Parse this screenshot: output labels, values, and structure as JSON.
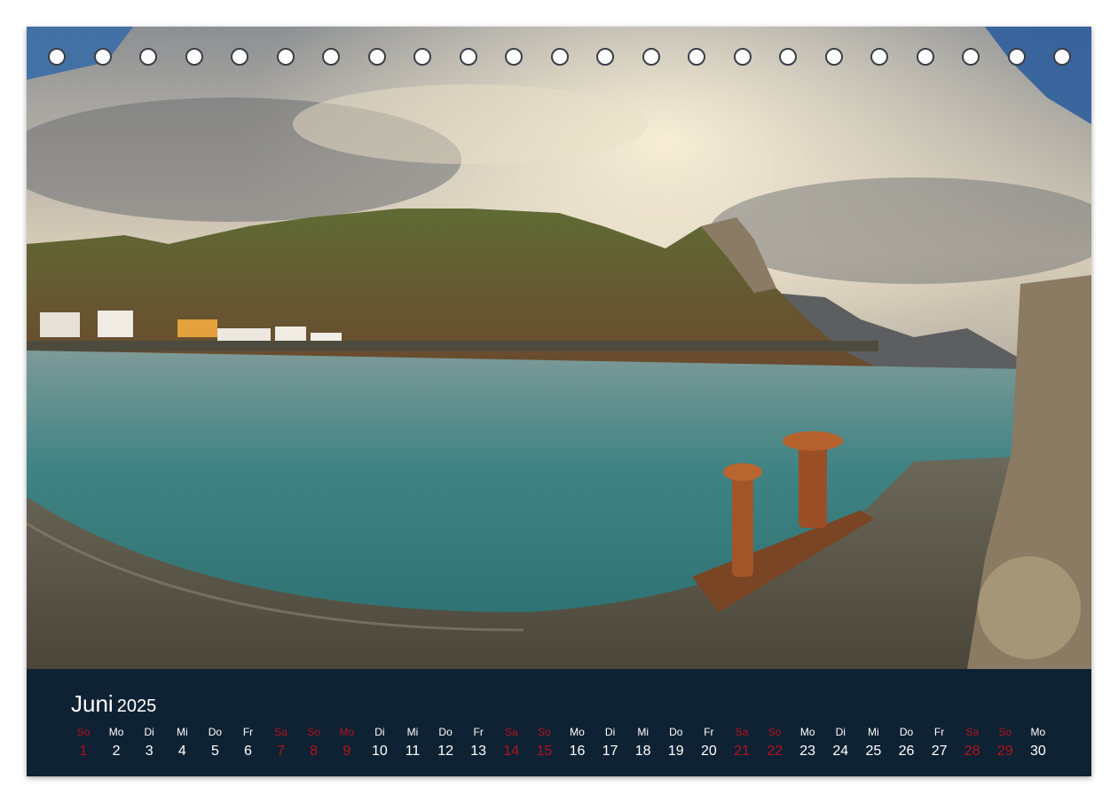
{
  "calendar": {
    "month": "Juni",
    "year": "2025",
    "weekend_color": "#b3121c",
    "days": [
      {
        "name": "So",
        "num": "1",
        "weekend": true
      },
      {
        "name": "Mo",
        "num": "2",
        "weekend": false
      },
      {
        "name": "Di",
        "num": "3",
        "weekend": false
      },
      {
        "name": "Mi",
        "num": "4",
        "weekend": false
      },
      {
        "name": "Do",
        "num": "5",
        "weekend": false
      },
      {
        "name": "Fr",
        "num": "6",
        "weekend": false
      },
      {
        "name": "Sa",
        "num": "7",
        "weekend": true
      },
      {
        "name": "So",
        "num": "8",
        "weekend": true
      },
      {
        "name": "Mo",
        "num": "9",
        "weekend": true
      },
      {
        "name": "Di",
        "num": "10",
        "weekend": false
      },
      {
        "name": "Mi",
        "num": "11",
        "weekend": false
      },
      {
        "name": "Do",
        "num": "12",
        "weekend": false
      },
      {
        "name": "Fr",
        "num": "13",
        "weekend": false
      },
      {
        "name": "Sa",
        "num": "14",
        "weekend": true
      },
      {
        "name": "So",
        "num": "15",
        "weekend": true
      },
      {
        "name": "Mo",
        "num": "16",
        "weekend": false
      },
      {
        "name": "Di",
        "num": "17",
        "weekend": false
      },
      {
        "name": "Mi",
        "num": "18",
        "weekend": false
      },
      {
        "name": "Do",
        "num": "19",
        "weekend": false
      },
      {
        "name": "Fr",
        "num": "20",
        "weekend": false
      },
      {
        "name": "Sa",
        "num": "21",
        "weekend": true
      },
      {
        "name": "So",
        "num": "22",
        "weekend": true
      },
      {
        "name": "Mo",
        "num": "23",
        "weekend": false
      },
      {
        "name": "Di",
        "num": "24",
        "weekend": false
      },
      {
        "name": "Mi",
        "num": "25",
        "weekend": false
      },
      {
        "name": "Do",
        "num": "26",
        "weekend": false
      },
      {
        "name": "Fr",
        "num": "27",
        "weekend": false
      },
      {
        "name": "Sa",
        "num": "28",
        "weekend": true
      },
      {
        "name": "So",
        "num": "29",
        "weekend": true
      },
      {
        "name": "Mo",
        "num": "30",
        "weekend": false
      }
    ]
  }
}
